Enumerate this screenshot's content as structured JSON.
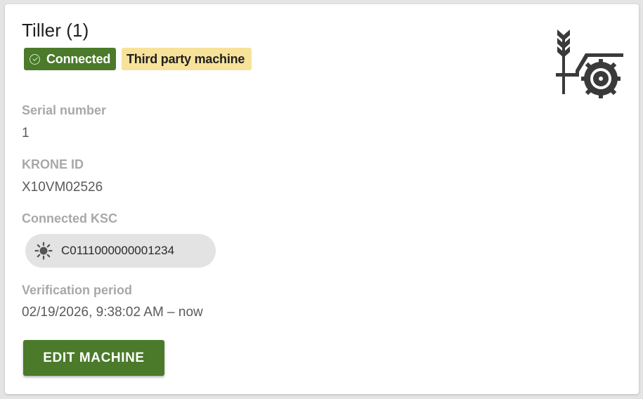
{
  "machine": {
    "title": "Tiller (1)",
    "icon": "tiller-machine-icon"
  },
  "badges": {
    "connected": {
      "label": "Connected",
      "icon": "check-circle-icon",
      "color": "#4a7a2a"
    },
    "third_party": {
      "label": "Third party machine",
      "color": "#f7e29a"
    }
  },
  "fields": {
    "serial_number": {
      "label": "Serial number",
      "value": "1"
    },
    "krone_id": {
      "label": "KRONE ID",
      "value": "X10VM02526"
    },
    "connected_ksc": {
      "label": "Connected KSC",
      "chip_value": "C0111000000001234",
      "chip_icon": "sun-icon"
    },
    "verification_period": {
      "label": "Verification period",
      "value": "02/19/2026, 9:38:02 AM – now"
    }
  },
  "actions": {
    "edit_label": "EDIT MACHINE",
    "accent_color": "#4a7a2a"
  }
}
